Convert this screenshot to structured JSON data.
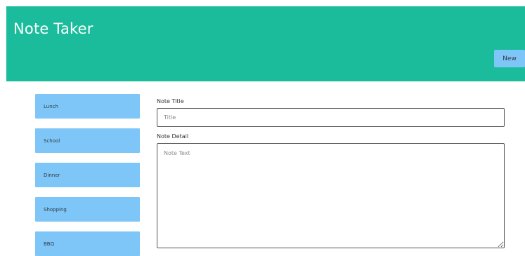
{
  "header": {
    "title": "Note Taker",
    "new_label": "New"
  },
  "sidebar": {
    "items": [
      {
        "label": "Lunch"
      },
      {
        "label": "School"
      },
      {
        "label": "Dinner"
      },
      {
        "label": "Shopping"
      },
      {
        "label": "BBQ"
      }
    ]
  },
  "form": {
    "title_label": "Note Title",
    "title_placeholder": "Title",
    "title_value": "",
    "detail_label": "Note Detail",
    "detail_placeholder": "Note Text",
    "detail_value": ""
  },
  "colors": {
    "header_bg": "#1abc9c",
    "button_bg": "#7fc6f8",
    "sidebar_item_bg": "#7fc6f8"
  }
}
